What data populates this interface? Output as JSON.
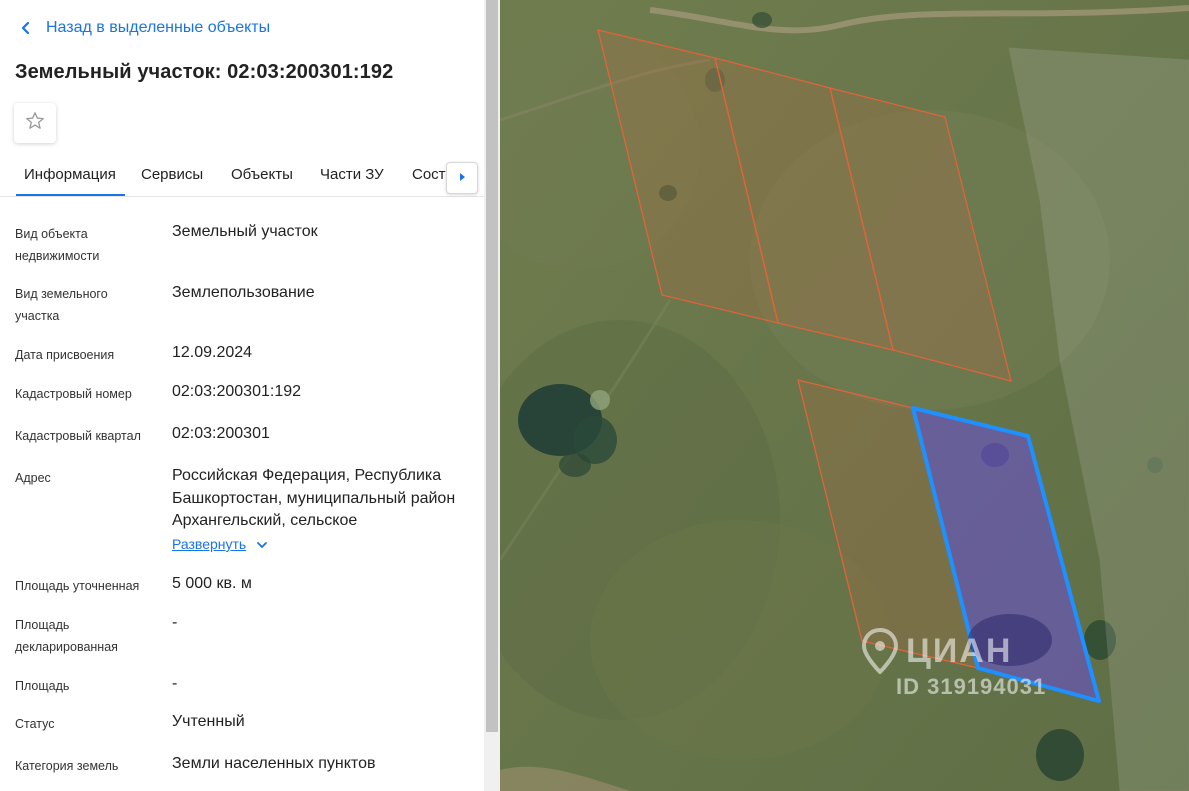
{
  "back_link": {
    "label": "Назад в выделенные объекты"
  },
  "object_title": "Земельный участок: 02:03:200301:192",
  "tabs": [
    {
      "label": "Информация",
      "active": true
    },
    {
      "label": "Сервисы"
    },
    {
      "label": "Объекты"
    },
    {
      "label": "Части ЗУ"
    },
    {
      "label": "Соста"
    }
  ],
  "info": {
    "object_type": {
      "label": "Вид объекта недвижимости",
      "value": "Земельный участок"
    },
    "land_type": {
      "label": "Вид земельного участка",
      "value": "Землепользование"
    },
    "assign_date": {
      "label": "Дата присвоения",
      "value": "12.09.2024"
    },
    "cadastral_number": {
      "label": "Кадастровый номер",
      "value": "02:03:200301:192"
    },
    "cadastral_quarter": {
      "label": "Кадастровый квартал",
      "value": "02:03:200301"
    },
    "address": {
      "label": "Адрес",
      "value": "Российская Федерация, Республика Башкортостан, муниципальный район Архангельский, сельское",
      "expand_label": "Развернуть"
    },
    "area_refined": {
      "label": "Площадь уточненная",
      "value": "5 000 кв. м"
    },
    "area_declared": {
      "label": "Площадь декларированная",
      "value": "-"
    },
    "area": {
      "label": "Площадь",
      "value": "-"
    },
    "status": {
      "label": "Статус",
      "value": "Учтенный"
    },
    "land_category": {
      "label": "Категория земель",
      "value": "Земли населенных пунктов"
    }
  },
  "map": {
    "watermark_brand": "ЦИАН",
    "watermark_id": "ID 319194031",
    "parcel_outline_color": "#e0643a",
    "selected_parcel_color": "#1e90ff",
    "selected_parcel_fill": "#6a4fd8"
  }
}
